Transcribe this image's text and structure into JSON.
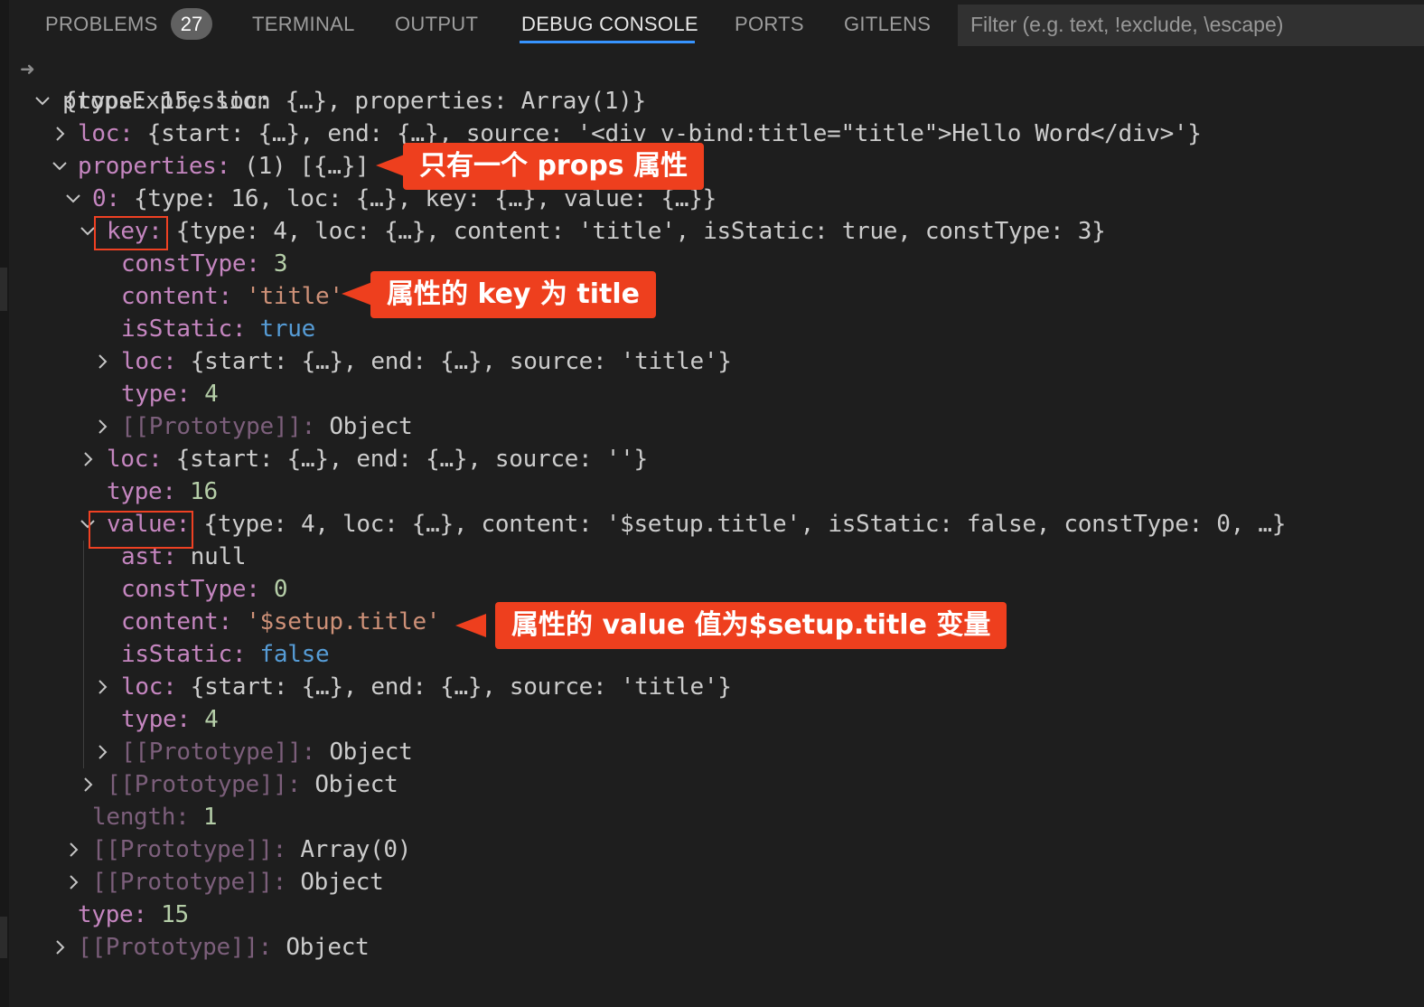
{
  "tabs": [
    {
      "label": "PROBLEMS"
    },
    {
      "label": "TERMINAL"
    },
    {
      "label": "OUTPUT"
    },
    {
      "label": "DEBUG CONSOLE"
    },
    {
      "label": "PORTS"
    },
    {
      "label": "GITLENS"
    }
  ],
  "problems_count": "27",
  "active_tab": "DEBUG CONSOLE",
  "filter": {
    "placeholder": "Filter (e.g. text, !exclude, \\escape)"
  },
  "console": {
    "expression": "propsExpression",
    "rows": [
      {
        "twisty": "open",
        "key": "",
        "sep": "",
        "value": "{type: 15, loc: {…}, properties: Array(1)}"
      },
      {
        "twisty": "closed",
        "key": "loc",
        "sep": ": ",
        "value": "{start: {…}, end: {…}, source: '<div v-bind:title=\"title\">Hello Word</div>'}"
      },
      {
        "twisty": "open",
        "key": "properties",
        "sep": ": ",
        "value": "(1) [{…}]"
      },
      {
        "twisty": "open",
        "key": "0",
        "sep": ": ",
        "value": "{type: 16, loc: {…}, key: {…}, value: {…}}"
      },
      {
        "twisty": "open",
        "key": "key",
        "sep": ":",
        "value": " {type: 4, loc: {…}, content: 'title', isStatic: true, constType: 3}"
      },
      {
        "twisty": "none",
        "key": "constType",
        "sep": ": ",
        "value": "3"
      },
      {
        "twisty": "none",
        "key": "content",
        "sep": ": ",
        "value": "'title'"
      },
      {
        "twisty": "none",
        "key": "isStatic",
        "sep": ": ",
        "value": "true"
      },
      {
        "twisty": "closed",
        "key": "loc",
        "sep": ": ",
        "value": "{start: {…}, end: {…}, source: 'title'}"
      },
      {
        "twisty": "none",
        "key": "type",
        "sep": ": ",
        "value": "4"
      },
      {
        "twisty": "closed",
        "key": "[[Prototype]]",
        "sep": ": ",
        "value": "Object"
      },
      {
        "twisty": "closed",
        "key": "loc",
        "sep": ": ",
        "value": "{start: {…}, end: {…}, source: ''}"
      },
      {
        "twisty": "none",
        "key": "type",
        "sep": ": ",
        "value": "16"
      },
      {
        "twisty": "open",
        "key": "value",
        "sep": ":",
        "value": " {type: 4, loc: {…}, content: '$setup.title', isStatic: false, constType: 0, …}"
      },
      {
        "twisty": "none",
        "key": "ast",
        "sep": ": ",
        "value": "null"
      },
      {
        "twisty": "none",
        "key": "constType",
        "sep": ": ",
        "value": "0"
      },
      {
        "twisty": "none",
        "key": "content",
        "sep": ": ",
        "value": "'$setup.title'"
      },
      {
        "twisty": "none",
        "key": "isStatic",
        "sep": ": ",
        "value": "false"
      },
      {
        "twisty": "closed",
        "key": "loc",
        "sep": ": ",
        "value": "{start: {…}, end: {…}, source: 'title'}"
      },
      {
        "twisty": "none",
        "key": "type",
        "sep": ": ",
        "value": "4"
      },
      {
        "twisty": "closed",
        "key": "[[Prototype]]",
        "sep": ": ",
        "value": "Object"
      },
      {
        "twisty": "closed",
        "key": "[[Prototype]]",
        "sep": ": ",
        "value": "Object"
      },
      {
        "twisty": "none",
        "key": "length",
        "sep": ": ",
        "value": "1"
      },
      {
        "twisty": "closed",
        "key": "[[Prototype]]",
        "sep": ": ",
        "value": "Array(0)"
      },
      {
        "twisty": "closed",
        "key": "[[Prototype]]",
        "sep": ": ",
        "value": "Object"
      },
      {
        "twisty": "none",
        "key": "type",
        "sep": ": ",
        "value": "15"
      },
      {
        "twisty": "closed",
        "key": "[[Prototype]]",
        "sep": ": ",
        "value": "Object"
      }
    ]
  },
  "annotations": [
    {
      "text": "只有一个 props 属性"
    },
    {
      "text": "属性的 key 为 title"
    },
    {
      "text": "属性的 value 值为$setup.title 变量"
    }
  ],
  "colors": {
    "background": "#1e1e1e",
    "property_key": "#c586c0",
    "string": "#ce9178",
    "number": "#b5cea8",
    "boolean": "#569cd6",
    "tab_underline": "#3794ff",
    "annotation": "#ee3f1e"
  }
}
